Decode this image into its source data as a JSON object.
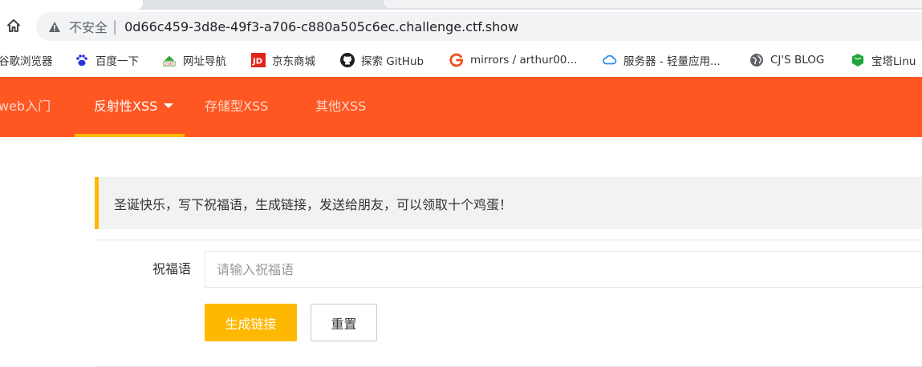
{
  "browser": {
    "insecure_label": "不安全",
    "separator": "|",
    "url": "0d66c459-3d8e-49f3-a706-c880a505c6ec.challenge.ctf.show"
  },
  "bookmarks": [
    {
      "label": "谷歌浏览器",
      "icon": "chrome-icon"
    },
    {
      "label": "百度一下",
      "icon": "baidu-paw-icon"
    },
    {
      "label": "网址导航",
      "icon": "hao123-icon"
    },
    {
      "label": "京东商城",
      "icon": "jd-icon"
    },
    {
      "label": "探索 GitHub",
      "icon": "github-icon"
    },
    {
      "label": "mirrors / arthur00...",
      "icon": "gitcode-g-icon"
    },
    {
      "label": "服务器 - 轻量应用...",
      "icon": "cloud-icon"
    },
    {
      "label": "CJ'S BLOG",
      "icon": "globe-icon"
    },
    {
      "label": "宝塔Linu",
      "icon": "bt-icon"
    }
  ],
  "nav": {
    "items": [
      {
        "label": "web入门"
      },
      {
        "label": "反射性XSS"
      },
      {
        "label": "存储型XSS"
      },
      {
        "label": "其他XSS"
      }
    ]
  },
  "notice": {
    "text": "圣诞快乐，写下祝福语，生成链接，发送给朋友，可以领取十个鸡蛋！"
  },
  "form": {
    "label": "祝福语",
    "placeholder": "请输入祝福语",
    "value": "",
    "submit_label": "生成链接",
    "reset_label": "重置"
  },
  "colors": {
    "nav_bg": "#ff5722",
    "accent": "#ffb800",
    "notice_bg": "#f2f2f2"
  }
}
